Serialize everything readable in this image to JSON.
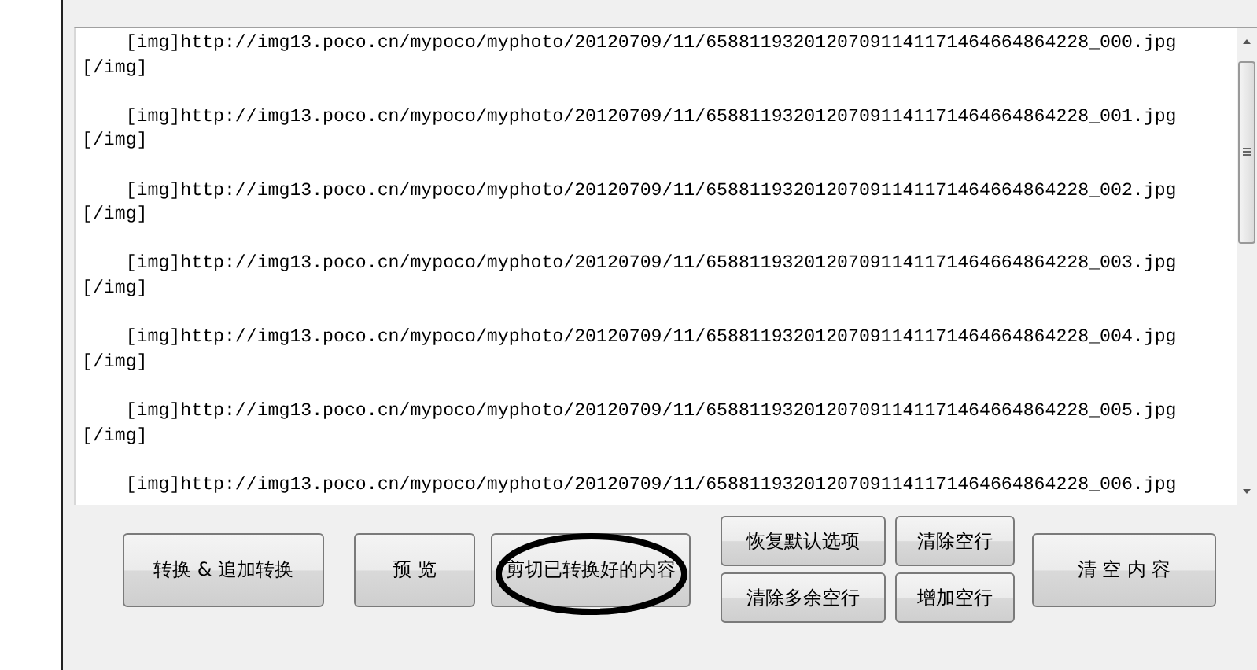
{
  "editor": {
    "entries": [
      {
        "open": "    [img]http://img13.poco.cn/mypoco/myphoto/20120709/11/65881193201207091141171464664864228_000.jpg",
        "close": "[/img]"
      },
      {
        "open": "    [img]http://img13.poco.cn/mypoco/myphoto/20120709/11/65881193201207091141171464664864228_001.jpg",
        "close": "[/img]"
      },
      {
        "open": "    [img]http://img13.poco.cn/mypoco/myphoto/20120709/11/65881193201207091141171464664864228_002.jpg",
        "close": "[/img]"
      },
      {
        "open": "    [img]http://img13.poco.cn/mypoco/myphoto/20120709/11/65881193201207091141171464664864228_003.jpg",
        "close": "[/img]"
      },
      {
        "open": "    [img]http://img13.poco.cn/mypoco/myphoto/20120709/11/65881193201207091141171464664864228_004.jpg",
        "close": "[/img]"
      },
      {
        "open": "    [img]http://img13.poco.cn/mypoco/myphoto/20120709/11/65881193201207091141171464664864228_005.jpg",
        "close": "[/img]"
      },
      {
        "open": "    [img]http://img13.poco.cn/mypoco/myphoto/20120709/11/65881193201207091141171464664864228_006.jpg"
      }
    ]
  },
  "buttons": {
    "convert": "转换 & 追加转换",
    "preview": "预 览",
    "cut": "剪切已转换好的内容",
    "restore_defaults": "恢复默认选项",
    "clear_blank_lines": "清除空行",
    "clear_extra_blank_lines": "清除多余空行",
    "add_blank_lines": "增加空行",
    "clear_content": "清 空 内 容"
  }
}
